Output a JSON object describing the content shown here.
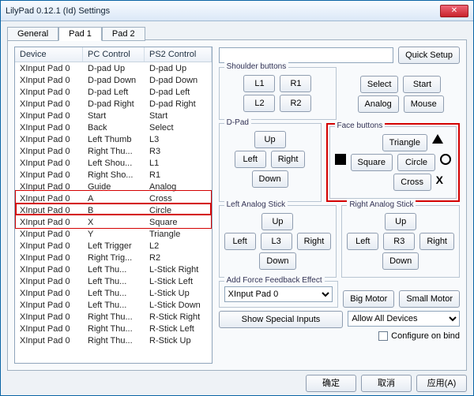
{
  "window": {
    "title": "LilyPad 0.12.1 (Id) Settings"
  },
  "tabs": [
    "General",
    "Pad 1",
    "Pad 2"
  ],
  "active_tab": 1,
  "list": {
    "headers": [
      "Device",
      "PC Control",
      "PS2 Control"
    ],
    "rows": [
      [
        "XInput Pad 0",
        "D-pad Up",
        "D-pad Up"
      ],
      [
        "XInput Pad 0",
        "D-pad Down",
        "D-pad Down"
      ],
      [
        "XInput Pad 0",
        "D-pad Left",
        "D-pad Left"
      ],
      [
        "XInput Pad 0",
        "D-pad Right",
        "D-pad Right"
      ],
      [
        "XInput Pad 0",
        "Start",
        "Start"
      ],
      [
        "XInput Pad 0",
        "Back",
        "Select"
      ],
      [
        "XInput Pad 0",
        "Left Thumb",
        "L3"
      ],
      [
        "XInput Pad 0",
        "Right Thu...",
        "R3"
      ],
      [
        "XInput Pad 0",
        "Left Shou...",
        "L1"
      ],
      [
        "XInput Pad 0",
        "Right Sho...",
        "R1"
      ],
      [
        "XInput Pad 0",
        "Guide",
        "Analog"
      ],
      [
        "XInput Pad 0",
        "A",
        "Cross"
      ],
      [
        "XInput Pad 0",
        "B",
        "Circle"
      ],
      [
        "XInput Pad 0",
        "X",
        "Square"
      ],
      [
        "XInput Pad 0",
        "Y",
        "Triangle"
      ],
      [
        "XInput Pad 0",
        "Left Trigger",
        "L2"
      ],
      [
        "XInput Pad 0",
        "Right Trig...",
        "R2"
      ],
      [
        "XInput Pad 0",
        "Left Thu...",
        "L-Stick Right"
      ],
      [
        "XInput Pad 0",
        "Left Thu...",
        "L-Stick Left"
      ],
      [
        "XInput Pad 0",
        "Left Thu...",
        "L-Stick Up"
      ],
      [
        "XInput Pad 0",
        "Left Thu...",
        "L-Stick Down"
      ],
      [
        "XInput Pad 0",
        "Right Thu...",
        "R-Stick Right"
      ],
      [
        "XInput Pad 0",
        "Right Thu...",
        "R-Stick Left"
      ],
      [
        "XInput Pad 0",
        "Right Thu...",
        "R-Stick Up"
      ]
    ],
    "highlight_start": 10,
    "highlight_main": 11,
    "highlight_end": 12
  },
  "right": {
    "quick_setup": "Quick Setup",
    "shoulder": {
      "legend": "Shoulder buttons",
      "L1": "L1",
      "R1": "R1",
      "L2": "L2",
      "R2": "R2"
    },
    "misc": {
      "select": "Select",
      "start": "Start",
      "analog": "Analog",
      "mouse": "Mouse"
    },
    "dpad": {
      "legend": "D-Pad",
      "up": "Up",
      "down": "Down",
      "left": "Left",
      "right": "Right"
    },
    "face": {
      "legend": "Face buttons",
      "triangle": "Triangle",
      "square": "Square",
      "circle": "Circle",
      "cross": "Cross"
    },
    "lstick": {
      "legend": "Left Analog Stick",
      "up": "Up",
      "down": "Down",
      "left": "Left",
      "right": "Right",
      "l3": "L3"
    },
    "rstick": {
      "legend": "Right Analog Stick",
      "up": "Up",
      "down": "Down",
      "left": "Left",
      "right": "Right",
      "r3": "R3"
    },
    "ffb": {
      "legend": "Add Force Feedback Effect",
      "selected": "XInput Pad 0",
      "big": "Big Motor",
      "small": "Small Motor"
    },
    "special": "Show Special Inputs",
    "allow": "Allow All Devices",
    "configure": "Configure on bind"
  },
  "footer": {
    "ok": "确定",
    "cancel": "取消",
    "apply": "应用(A)"
  }
}
